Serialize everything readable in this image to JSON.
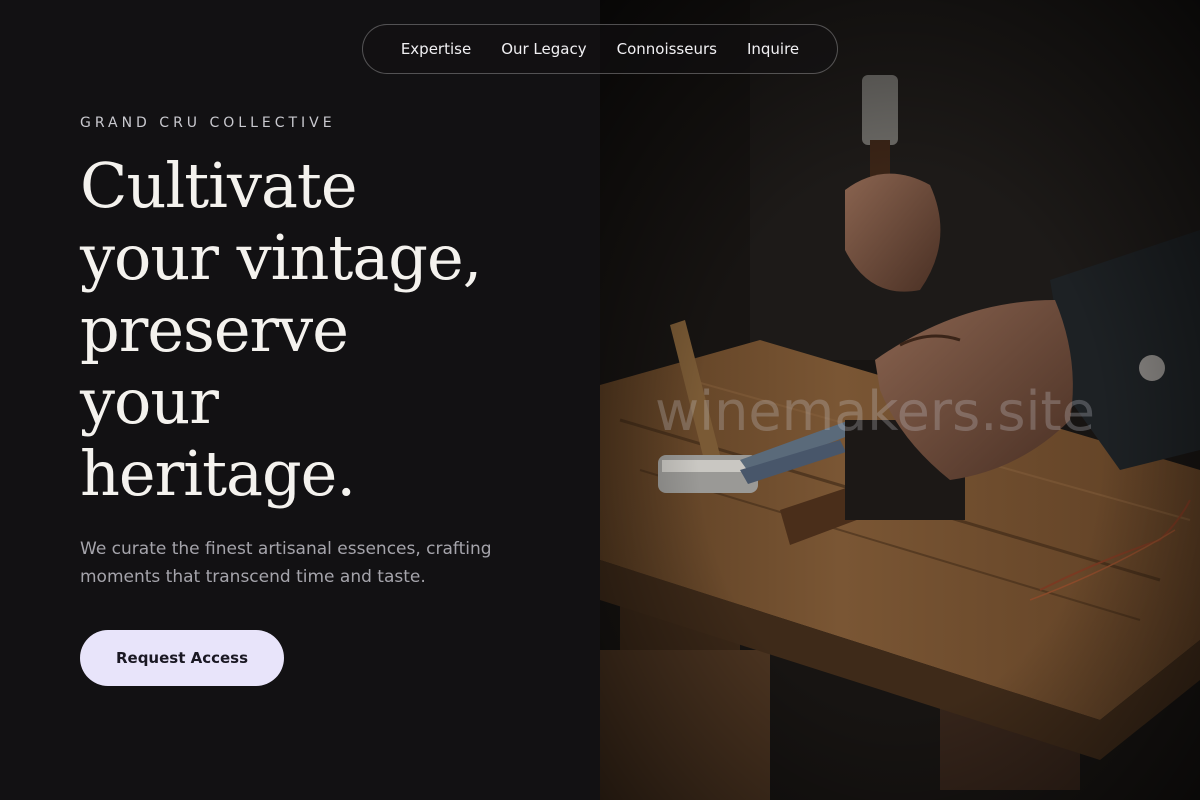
{
  "nav": {
    "items": [
      {
        "label": "Expertise"
      },
      {
        "label": "Our Legacy"
      },
      {
        "label": "Connoisseurs"
      },
      {
        "label": "Inquire"
      }
    ]
  },
  "hero": {
    "eyebrow": "GRAND CRU COLLECTIVE",
    "headline_lines": [
      "Cultivate",
      "your vintage,",
      "preserve",
      "your",
      "heritage."
    ],
    "subtext": "We curate the finest artisanal essences, crafting moments that transcend time and taste.",
    "cta_label": "Request Access"
  },
  "image": {
    "watermark": "winemakers.site"
  },
  "colors": {
    "background": "#121113",
    "cta_background": "#e8e4fa",
    "headline": "#f4f2ee",
    "body_text": "#a5a4ab"
  }
}
